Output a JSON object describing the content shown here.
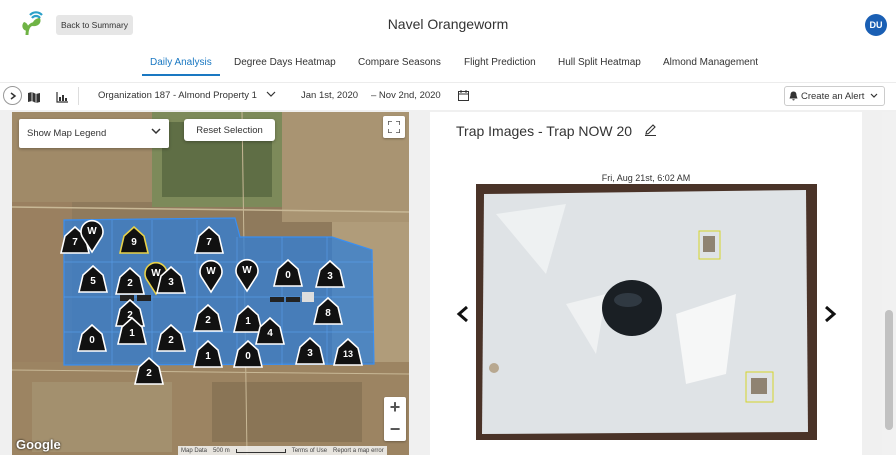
{
  "header": {
    "back_label": "Back to Summary",
    "title": "Navel Orangeworm",
    "avatar_initials": "DU"
  },
  "tabs": [
    {
      "label": "Daily Analysis",
      "active": true
    },
    {
      "label": "Degree Days Heatmap",
      "active": false
    },
    {
      "label": "Compare Seasons",
      "active": false
    },
    {
      "label": "Flight Prediction",
      "active": false
    },
    {
      "label": "Hull Split Heatmap",
      "active": false
    },
    {
      "label": "Almond Management",
      "active": false
    }
  ],
  "toolbar": {
    "organization": "Organization 187 - Almond Property 1",
    "date_start": "Jan 1st, 2020",
    "date_end": "– Nov 2nd, 2020",
    "alert_label": "Create an Alert"
  },
  "map": {
    "legend_select": "Show Map Legend",
    "reset_label": "Reset Selection",
    "zoom_in": "+",
    "zoom_out": "−",
    "brand": "Google",
    "attribution": [
      "Map Data",
      "500 m",
      "Terms of Use",
      "Report a map error"
    ],
    "markers": [
      "7",
      "W",
      "9",
      "7",
      "5",
      "2",
      "W",
      "3",
      "W",
      "W",
      "0",
      "3",
      "2",
      "1",
      "4",
      "2",
      "8",
      "0",
      "1",
      "2",
      "1",
      "0",
      "3",
      "13",
      "2"
    ]
  },
  "trap": {
    "title": "Trap Images - Trap  NOW 20",
    "timestamp": "Fri, Aug 21st, 6:02 AM"
  },
  "colors": {
    "accent": "#1a78c2",
    "field_overlay": "#2f7fd8",
    "marker_fill": "#111111",
    "marker_selected_border": "#e8d24a"
  }
}
